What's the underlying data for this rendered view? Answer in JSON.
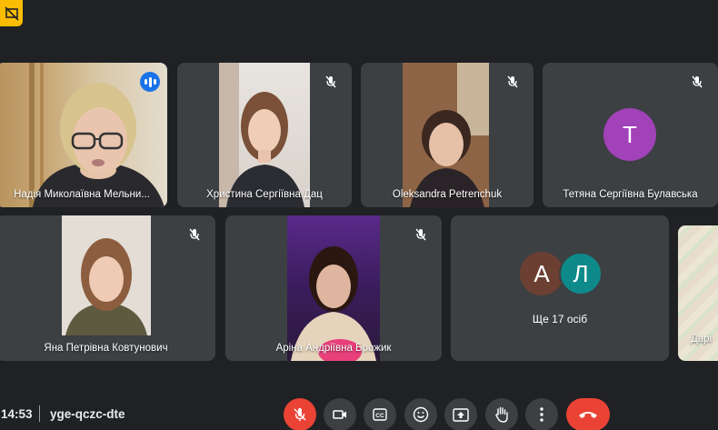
{
  "participants": [
    {
      "name": "Надія Миколаївна Мельни...",
      "state": "speaking"
    },
    {
      "name": "Христина Сергіївна Дац",
      "state": "muted"
    },
    {
      "name": "Oleksandra Petrenchuk",
      "state": "muted"
    },
    {
      "name": "Тетяна Сергіївна Булавська",
      "state": "muted",
      "avatar_letter": "Т",
      "avatar_color": "#a142b8"
    },
    {
      "name": "Яна Петрівна Ковтунович",
      "state": "muted"
    },
    {
      "name": "Аріна Андріївна Брожик",
      "state": "muted"
    },
    {
      "name": "Дарі",
      "state": "partial"
    }
  ],
  "others": {
    "letters": [
      "А",
      "Л"
    ],
    "colors": [
      "#6b3f31",
      "#0f8a8a"
    ],
    "label": "Ще 17 осіб"
  },
  "bottom_bar": {
    "time": "14:53",
    "separator": "|",
    "meeting_code": "yge-qczc-dte",
    "controls": [
      "mic-off",
      "camera",
      "captions",
      "emoji",
      "present",
      "raise-hand",
      "more",
      "leave-call"
    ]
  },
  "colors": {
    "background": "#202124",
    "tile": "#3c4043",
    "active_outline": "#8ab4f8",
    "danger": "#ea4335",
    "badge": "#fbbc04"
  }
}
